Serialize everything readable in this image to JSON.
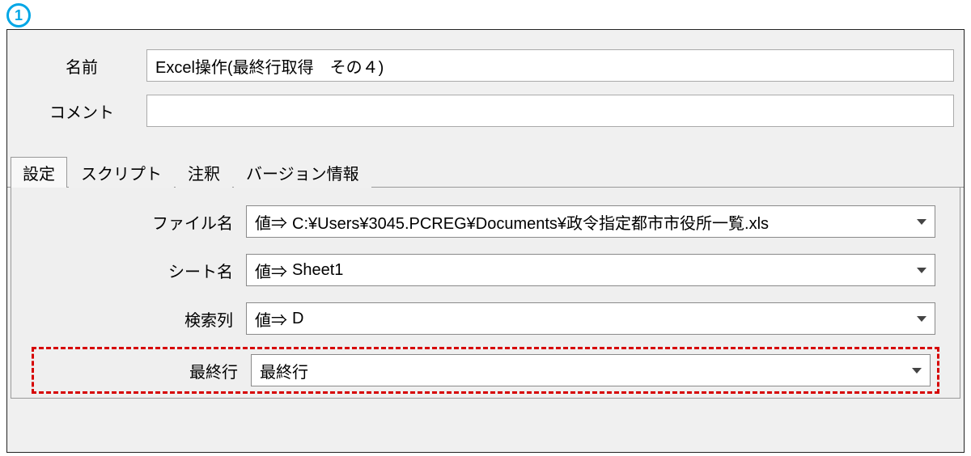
{
  "step_number": "1",
  "header": {
    "name_label": "名前",
    "name_value": "Excel操作(最終行取得　その４)",
    "comment_label": "コメント",
    "comment_value": ""
  },
  "tabs": [
    {
      "label": "設定"
    },
    {
      "label": "スクリプト"
    },
    {
      "label": "注釈"
    },
    {
      "label": "バージョン情報"
    }
  ],
  "settings": {
    "value_prefix": "値⇒",
    "file_label": "ファイル名",
    "file_value": "C:¥Users¥3045.PCREG¥Documents¥政令指定都市市役所一覧.xls",
    "sheet_label": "シート名",
    "sheet_value": "Sheet1",
    "column_label": "検索列",
    "column_value": "D",
    "lastrow_label": "最終行",
    "lastrow_value": "最終行"
  }
}
